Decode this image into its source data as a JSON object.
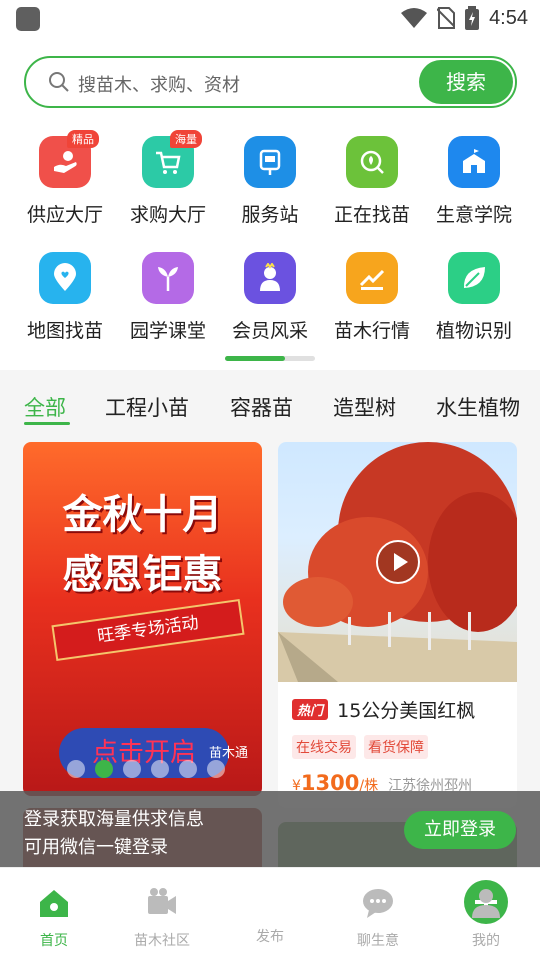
{
  "status_bar": {
    "time": "4:54"
  },
  "search": {
    "placeholder": "搜苗木、求购、资材",
    "button": "搜索"
  },
  "grid": [
    {
      "label": "供应大厅",
      "badge": "精品",
      "color": "#f0504a",
      "icon": "hand-icon"
    },
    {
      "label": "求购大厅",
      "badge": "海量",
      "color": "#2ccaa6",
      "icon": "cart-icon"
    },
    {
      "label": "服务站",
      "badge": "",
      "color": "#1e8fe6",
      "icon": "kiosk-icon"
    },
    {
      "label": "正在找苗",
      "badge": "",
      "color": "#6cc23a",
      "icon": "search-leaf-icon"
    },
    {
      "label": "生意学院",
      "badge": "",
      "color": "#1e88ee",
      "icon": "school-icon"
    },
    {
      "label": "地图找苗",
      "badge": "",
      "color": "#27b3ee",
      "icon": "map-pin-icon"
    },
    {
      "label": "园学课堂",
      "badge": "",
      "color": "#b46ae6",
      "icon": "sprout-icon"
    },
    {
      "label": "会员风采",
      "badge": "",
      "color": "#6b52e0",
      "icon": "member-icon"
    },
    {
      "label": "苗木行情",
      "badge": "",
      "color": "#f7a51d",
      "icon": "trend-icon"
    },
    {
      "label": "植物识别",
      "badge": "",
      "color": "#2ccf86",
      "icon": "leaf-icon"
    }
  ],
  "tabs": [
    "全部",
    "工程小苗",
    "容器苗",
    "造型树",
    "水生植物"
  ],
  "promo": {
    "line1": "金秋十月",
    "line2": "感恩钜惠",
    "ribbon": "旺季专场活动",
    "pill": "点击开启",
    "logo": "苗木通"
  },
  "product": {
    "hot_label": "热门",
    "title": "15公分美国红枫",
    "tags": [
      "在线交易",
      "看货保障"
    ],
    "currency": "¥",
    "price": "1300",
    "unit": "/株",
    "location": "江苏徐州邳州"
  },
  "login_prompt": {
    "line1": "登录获取海量供求信息",
    "line2": "可用微信一键登录",
    "button": "立即登录"
  },
  "nav": [
    {
      "label": "首页",
      "icon": "home-icon",
      "active": true
    },
    {
      "label": "苗木社区",
      "icon": "video-icon",
      "active": false
    },
    {
      "label": "发布",
      "icon": "plus-icon",
      "active": false
    },
    {
      "label": "聊生意",
      "icon": "chat-icon",
      "active": false
    },
    {
      "label": "我的",
      "icon": "profile-icon",
      "active": false
    }
  ],
  "colors": {
    "accent": "#3db549",
    "price": "#f26b1d",
    "hot": "#e02f2f"
  }
}
